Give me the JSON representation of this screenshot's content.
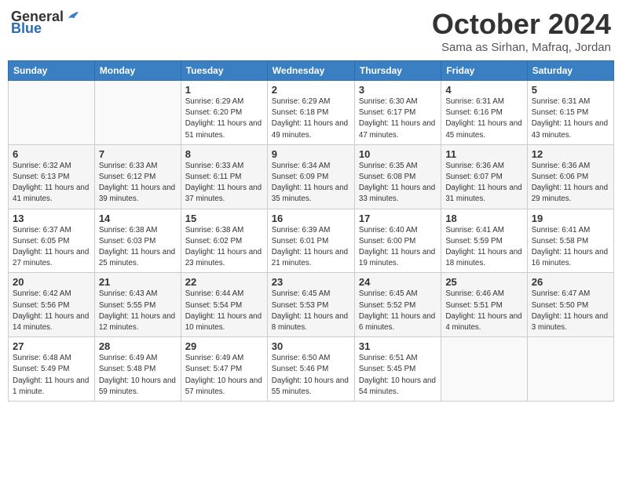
{
  "logo": {
    "general": "General",
    "blue": "Blue"
  },
  "title": "October 2024",
  "subtitle": "Sama as Sirhan, Mafraq, Jordan",
  "days_of_week": [
    "Sunday",
    "Monday",
    "Tuesday",
    "Wednesday",
    "Thursday",
    "Friday",
    "Saturday"
  ],
  "weeks": [
    [
      {
        "day": "",
        "info": ""
      },
      {
        "day": "",
        "info": ""
      },
      {
        "day": "1",
        "info": "Sunrise: 6:29 AM\nSunset: 6:20 PM\nDaylight: 11 hours and 51 minutes."
      },
      {
        "day": "2",
        "info": "Sunrise: 6:29 AM\nSunset: 6:18 PM\nDaylight: 11 hours and 49 minutes."
      },
      {
        "day": "3",
        "info": "Sunrise: 6:30 AM\nSunset: 6:17 PM\nDaylight: 11 hours and 47 minutes."
      },
      {
        "day": "4",
        "info": "Sunrise: 6:31 AM\nSunset: 6:16 PM\nDaylight: 11 hours and 45 minutes."
      },
      {
        "day": "5",
        "info": "Sunrise: 6:31 AM\nSunset: 6:15 PM\nDaylight: 11 hours and 43 minutes."
      }
    ],
    [
      {
        "day": "6",
        "info": "Sunrise: 6:32 AM\nSunset: 6:13 PM\nDaylight: 11 hours and 41 minutes."
      },
      {
        "day": "7",
        "info": "Sunrise: 6:33 AM\nSunset: 6:12 PM\nDaylight: 11 hours and 39 minutes."
      },
      {
        "day": "8",
        "info": "Sunrise: 6:33 AM\nSunset: 6:11 PM\nDaylight: 11 hours and 37 minutes."
      },
      {
        "day": "9",
        "info": "Sunrise: 6:34 AM\nSunset: 6:09 PM\nDaylight: 11 hours and 35 minutes."
      },
      {
        "day": "10",
        "info": "Sunrise: 6:35 AM\nSunset: 6:08 PM\nDaylight: 11 hours and 33 minutes."
      },
      {
        "day": "11",
        "info": "Sunrise: 6:36 AM\nSunset: 6:07 PM\nDaylight: 11 hours and 31 minutes."
      },
      {
        "day": "12",
        "info": "Sunrise: 6:36 AM\nSunset: 6:06 PM\nDaylight: 11 hours and 29 minutes."
      }
    ],
    [
      {
        "day": "13",
        "info": "Sunrise: 6:37 AM\nSunset: 6:05 PM\nDaylight: 11 hours and 27 minutes."
      },
      {
        "day": "14",
        "info": "Sunrise: 6:38 AM\nSunset: 6:03 PM\nDaylight: 11 hours and 25 minutes."
      },
      {
        "day": "15",
        "info": "Sunrise: 6:38 AM\nSunset: 6:02 PM\nDaylight: 11 hours and 23 minutes."
      },
      {
        "day": "16",
        "info": "Sunrise: 6:39 AM\nSunset: 6:01 PM\nDaylight: 11 hours and 21 minutes."
      },
      {
        "day": "17",
        "info": "Sunrise: 6:40 AM\nSunset: 6:00 PM\nDaylight: 11 hours and 19 minutes."
      },
      {
        "day": "18",
        "info": "Sunrise: 6:41 AM\nSunset: 5:59 PM\nDaylight: 11 hours and 18 minutes."
      },
      {
        "day": "19",
        "info": "Sunrise: 6:41 AM\nSunset: 5:58 PM\nDaylight: 11 hours and 16 minutes."
      }
    ],
    [
      {
        "day": "20",
        "info": "Sunrise: 6:42 AM\nSunset: 5:56 PM\nDaylight: 11 hours and 14 minutes."
      },
      {
        "day": "21",
        "info": "Sunrise: 6:43 AM\nSunset: 5:55 PM\nDaylight: 11 hours and 12 minutes."
      },
      {
        "day": "22",
        "info": "Sunrise: 6:44 AM\nSunset: 5:54 PM\nDaylight: 11 hours and 10 minutes."
      },
      {
        "day": "23",
        "info": "Sunrise: 6:45 AM\nSunset: 5:53 PM\nDaylight: 11 hours and 8 minutes."
      },
      {
        "day": "24",
        "info": "Sunrise: 6:45 AM\nSunset: 5:52 PM\nDaylight: 11 hours and 6 minutes."
      },
      {
        "day": "25",
        "info": "Sunrise: 6:46 AM\nSunset: 5:51 PM\nDaylight: 11 hours and 4 minutes."
      },
      {
        "day": "26",
        "info": "Sunrise: 6:47 AM\nSunset: 5:50 PM\nDaylight: 11 hours and 3 minutes."
      }
    ],
    [
      {
        "day": "27",
        "info": "Sunrise: 6:48 AM\nSunset: 5:49 PM\nDaylight: 11 hours and 1 minute."
      },
      {
        "day": "28",
        "info": "Sunrise: 6:49 AM\nSunset: 5:48 PM\nDaylight: 10 hours and 59 minutes."
      },
      {
        "day": "29",
        "info": "Sunrise: 6:49 AM\nSunset: 5:47 PM\nDaylight: 10 hours and 57 minutes."
      },
      {
        "day": "30",
        "info": "Sunrise: 6:50 AM\nSunset: 5:46 PM\nDaylight: 10 hours and 55 minutes."
      },
      {
        "day": "31",
        "info": "Sunrise: 6:51 AM\nSunset: 5:45 PM\nDaylight: 10 hours and 54 minutes."
      },
      {
        "day": "",
        "info": ""
      },
      {
        "day": "",
        "info": ""
      }
    ]
  ]
}
